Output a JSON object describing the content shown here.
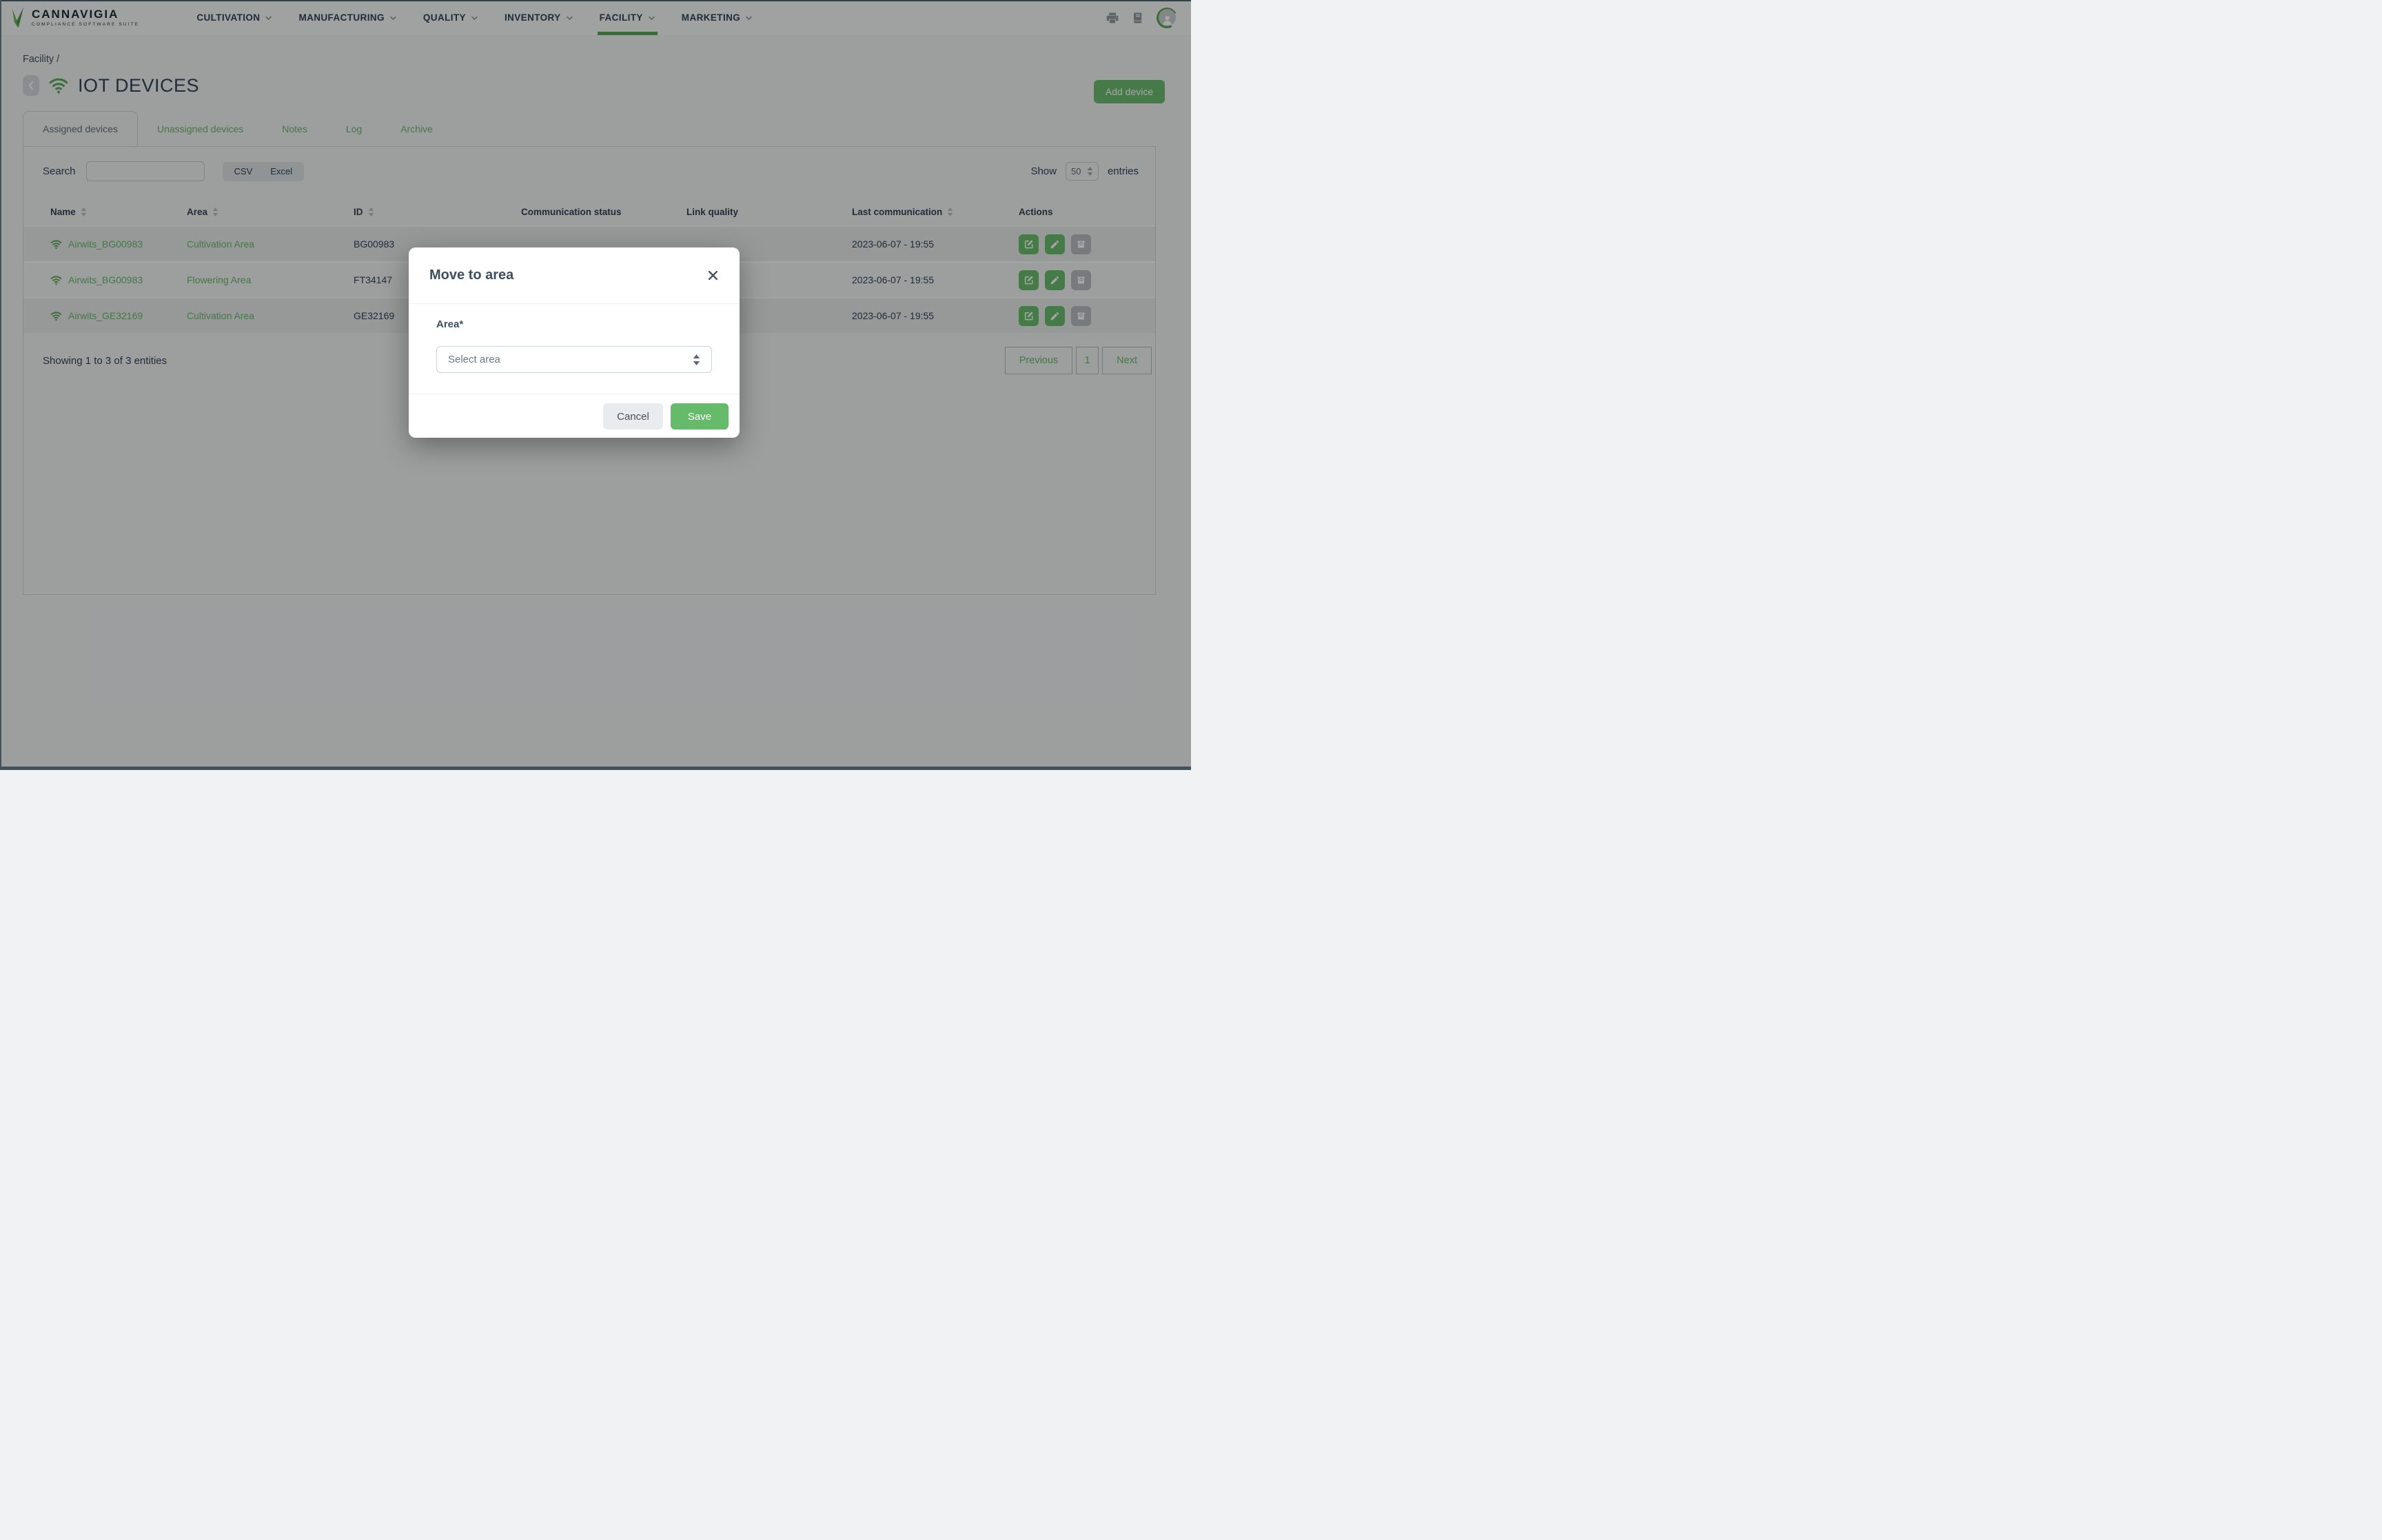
{
  "brand": {
    "name": "CANNAVIGIA",
    "tagline": "COMPLIANCE SOFTWARE SUITE"
  },
  "nav": {
    "items": [
      {
        "label": "CULTIVATION"
      },
      {
        "label": "MANUFACTURING"
      },
      {
        "label": "QUALITY"
      },
      {
        "label": "INVENTORY"
      },
      {
        "label": "FACILITY",
        "active": true
      },
      {
        "label": "MARKETING"
      }
    ]
  },
  "breadcrumb": {
    "text": "Facility /"
  },
  "page": {
    "title": "IOT DEVICES",
    "add_button_label": "Add device"
  },
  "tabs": [
    {
      "label": "Assigned devices",
      "active": true
    },
    {
      "label": "Unassigned devices"
    },
    {
      "label": "Notes"
    },
    {
      "label": "Log"
    },
    {
      "label": "Archive"
    }
  ],
  "toolbar": {
    "search_label": "Search",
    "search_value": "",
    "csv_label": "CSV",
    "excel_label": "Excel",
    "show_label": "Show",
    "page_size": "50",
    "entries_label": "entries"
  },
  "table": {
    "columns": [
      {
        "label": "Name",
        "sortable": true
      },
      {
        "label": "Area",
        "sortable": true
      },
      {
        "label": "ID",
        "sortable": true
      },
      {
        "label": "Communication status",
        "sortable": false
      },
      {
        "label": "Link quality",
        "sortable": false
      },
      {
        "label": "Last communication",
        "sortable": true
      },
      {
        "label": "Actions",
        "sortable": false
      }
    ],
    "rows": [
      {
        "name": "Airwits_BG00983",
        "area": "Cultivation Area",
        "device_id": "BG00983",
        "communication_status": "",
        "link_quality": "",
        "last_communication": "2023-06-07 - 19:55"
      },
      {
        "name": "Airwits_BG00983",
        "area": "Flowering Area",
        "device_id": "FT34147",
        "communication_status": "",
        "link_quality": "",
        "last_communication": "2023-06-07 - 19:55"
      },
      {
        "name": "Airwits_GE32169",
        "area": "Cultivation Area",
        "device_id": "GE32169",
        "communication_status": "",
        "link_quality": "",
        "last_communication": "2023-06-07 - 19:55"
      }
    ]
  },
  "footer": {
    "summary": "Showing 1 to 3 of 3 entities",
    "previous_label": "Previous",
    "page_number": "1",
    "next_label": "Next"
  },
  "modal": {
    "title": "Move to area",
    "area_label": "Area*",
    "select_placeholder": "Select area",
    "cancel_label": "Cancel",
    "save_label": "Save"
  },
  "colors": {
    "brand_green": "#67b56a",
    "button_green": "#66bb6a",
    "nav_text": "#2c3e50",
    "page_overlay": "rgba(8,10,12,0.36)"
  }
}
